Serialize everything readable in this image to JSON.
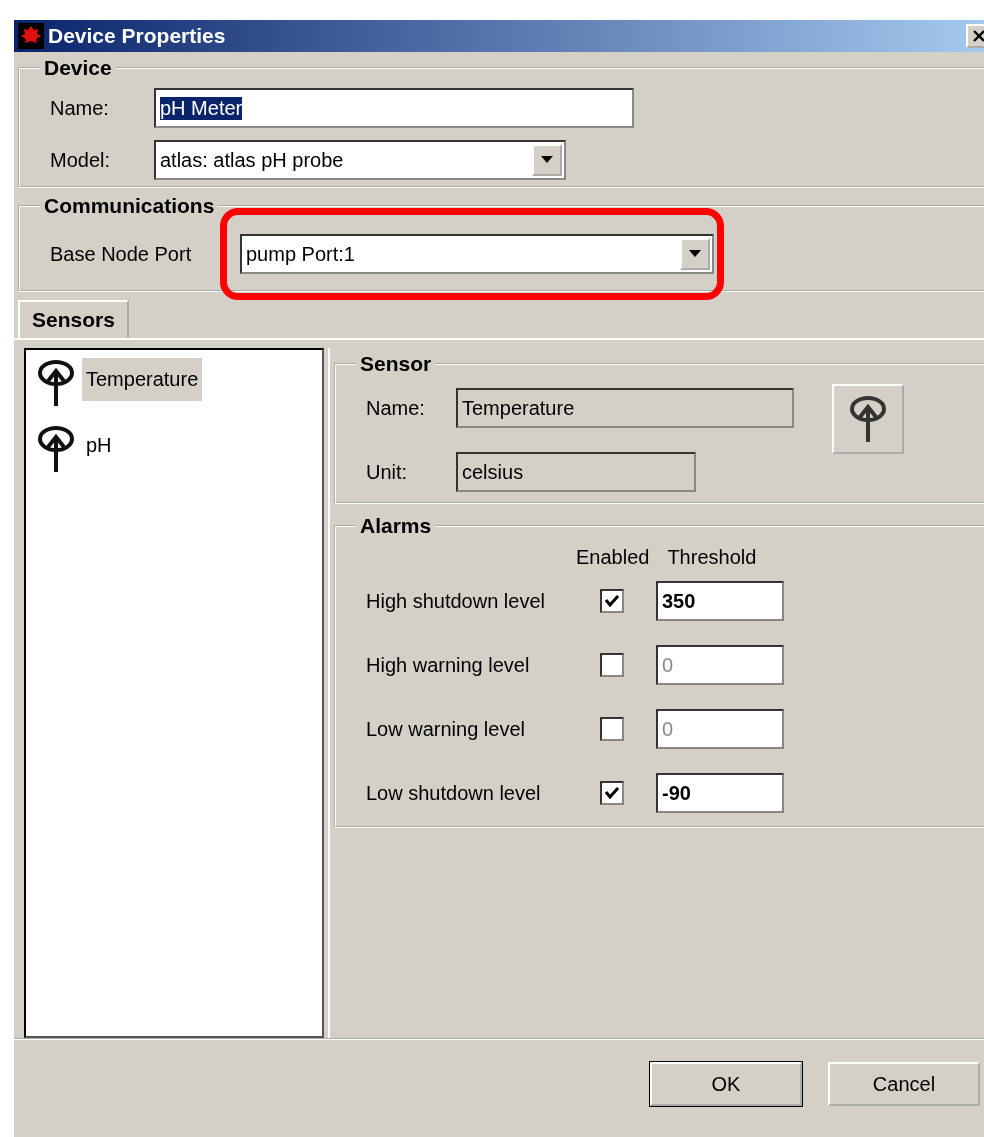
{
  "window": {
    "title": "Device Properties"
  },
  "device": {
    "legend": "Device",
    "name": {
      "label": "Name:",
      "value": "pH Meter",
      "text_selected": true
    },
    "model": {
      "label": "Model:",
      "value": "atlas: atlas pH probe"
    }
  },
  "communications": {
    "legend": "Communications",
    "base_node_port": {
      "label": "Base Node Port",
      "value": "pump Port:1",
      "highlighted": true
    }
  },
  "tabs": [
    {
      "label": "Sensors",
      "selected": true
    }
  ],
  "sensors": [
    {
      "name": "Temperature",
      "selected": true
    },
    {
      "name": "pH",
      "selected": false
    }
  ],
  "sensor": {
    "legend": "Sensor",
    "name_label": "Name:",
    "name": "Temperature",
    "unit_label": "Unit:",
    "unit": "celsius"
  },
  "alarms": {
    "legend": "Alarms",
    "enabled_header": "Enabled",
    "threshold_header": "Threshold",
    "rows": [
      {
        "label": "High shutdown level",
        "checked": true,
        "threshold": "350"
      },
      {
        "label": "High warning level",
        "checked": false,
        "threshold": "0"
      },
      {
        "label": "Low warning level",
        "checked": false,
        "threshold": "0"
      },
      {
        "label": "Low shutdown level",
        "checked": true,
        "threshold": "-90"
      }
    ]
  },
  "buttons": [
    {
      "label": "OK",
      "default": true
    },
    {
      "label": "Cancel",
      "default": false
    }
  ]
}
